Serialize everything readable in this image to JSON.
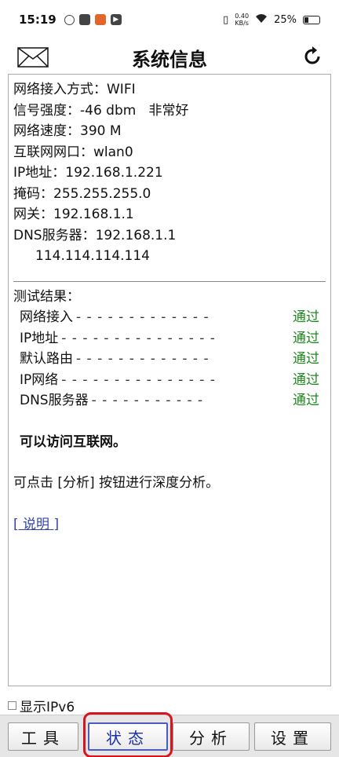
{
  "status": {
    "time": "15:19",
    "net_speed_value": "0.40",
    "net_speed_unit": "KB/s",
    "battery": "25%"
  },
  "header": {
    "title": "系统信息"
  },
  "info": {
    "access_mode": "网络接入方式：WIFI",
    "signal": "信号强度：-46 dbm   非常好",
    "speed": "网络速度：390 M",
    "interface": "互联网网口：wlan0",
    "ip": "IP地址：192.168.1.221",
    "mask": "掩码：255.255.255.0",
    "gateway": "网关：192.168.1.1",
    "dns_label": "DNS服务器：192.168.1.1",
    "dns_secondary": "114.114.114.114"
  },
  "results": {
    "heading": "测试结果：",
    "items": [
      {
        "label": "网络接入",
        "dots": "- - - - - - - - - - - - -",
        "status": "通过"
      },
      {
        "label": "IP地址",
        "dots": "- - - - - - - - - - - - - - -",
        "status": "通过"
      },
      {
        "label": "默认路由",
        "dots": "- - - - - - - - - - - - -",
        "status": "通过"
      },
      {
        "label": "IP网络",
        "dots": "- - - - - - - - - - - - - - -",
        "status": "通过"
      },
      {
        "label": "DNS服务器",
        "dots": "- - - - - - - - - - -",
        "status": "通过"
      }
    ],
    "summary": "可以访问互联网。",
    "hint": "可点击 [分析] 按钮进行深度分析。",
    "help_link": "[ 说明 ]"
  },
  "options": {
    "show_ipv6": "显示IPv6"
  },
  "toolbar": {
    "tools": "工具",
    "status": "状态",
    "analyze": "分析",
    "settings": "设置"
  },
  "colors": {
    "pass": "#1a8a1a",
    "link": "#3344aa",
    "active_tab": "#1b2fa8",
    "highlight": "#d9141c"
  }
}
